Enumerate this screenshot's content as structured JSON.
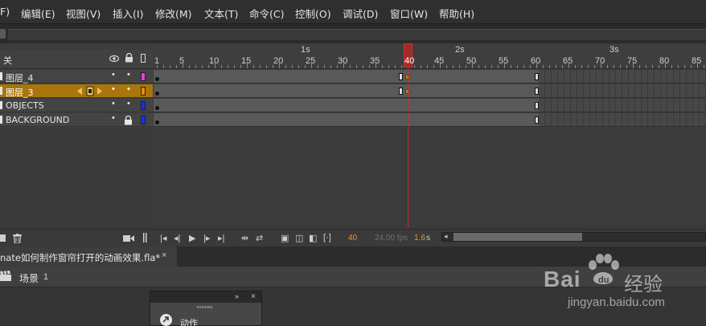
{
  "menu": {
    "items": [
      "F)",
      "编辑(E)",
      "视图(V)",
      "插入(I)",
      "修改(M)",
      "文本(T)",
      "命令(C)",
      "控制(O)",
      "调试(D)",
      "窗口(W)",
      "帮助(H)"
    ]
  },
  "layers": {
    "header_label": "关",
    "rows": [
      {
        "name": "图层_4",
        "color": "#e040e0",
        "selected": false,
        "locked": false
      },
      {
        "name": "图层_3",
        "color": "#f08a00",
        "selected": true,
        "locked": false
      },
      {
        "name": "OBJECTS",
        "color": "#1a2ee6",
        "selected": false,
        "locked": false
      },
      {
        "name": "BACKGROUND",
        "color": "#1a2ee6",
        "selected": false,
        "locked": true
      }
    ],
    "eye_icon": "eye-icon",
    "lock_icon": "lock-icon",
    "outline_icon": "outline-icon"
  },
  "ruler": {
    "seconds": [
      "1s",
      "2s",
      "3s"
    ],
    "frames": [
      "1",
      "5",
      "10",
      "15",
      "20",
      "25",
      "30",
      "35",
      "40",
      "45",
      "50",
      "55",
      "60",
      "65",
      "70",
      "75",
      "80",
      "85"
    ]
  },
  "playhead": {
    "frame": "40"
  },
  "toolbar": {
    "current_frame": "40",
    "fps": "24.00 fps",
    "time": "1.6",
    "time_unit": "s"
  },
  "document": {
    "tab_title": "nate如何制作窗帘打开的动画效果.fla*",
    "close": "×"
  },
  "scene": {
    "label": "场景",
    "number": "1"
  },
  "actions_panel": {
    "label": "动作",
    "collapse": "»",
    "close": "×"
  },
  "watermark": {
    "logo": "Bai",
    "cn": "经验",
    "url": "jingyan.baidu.com"
  }
}
